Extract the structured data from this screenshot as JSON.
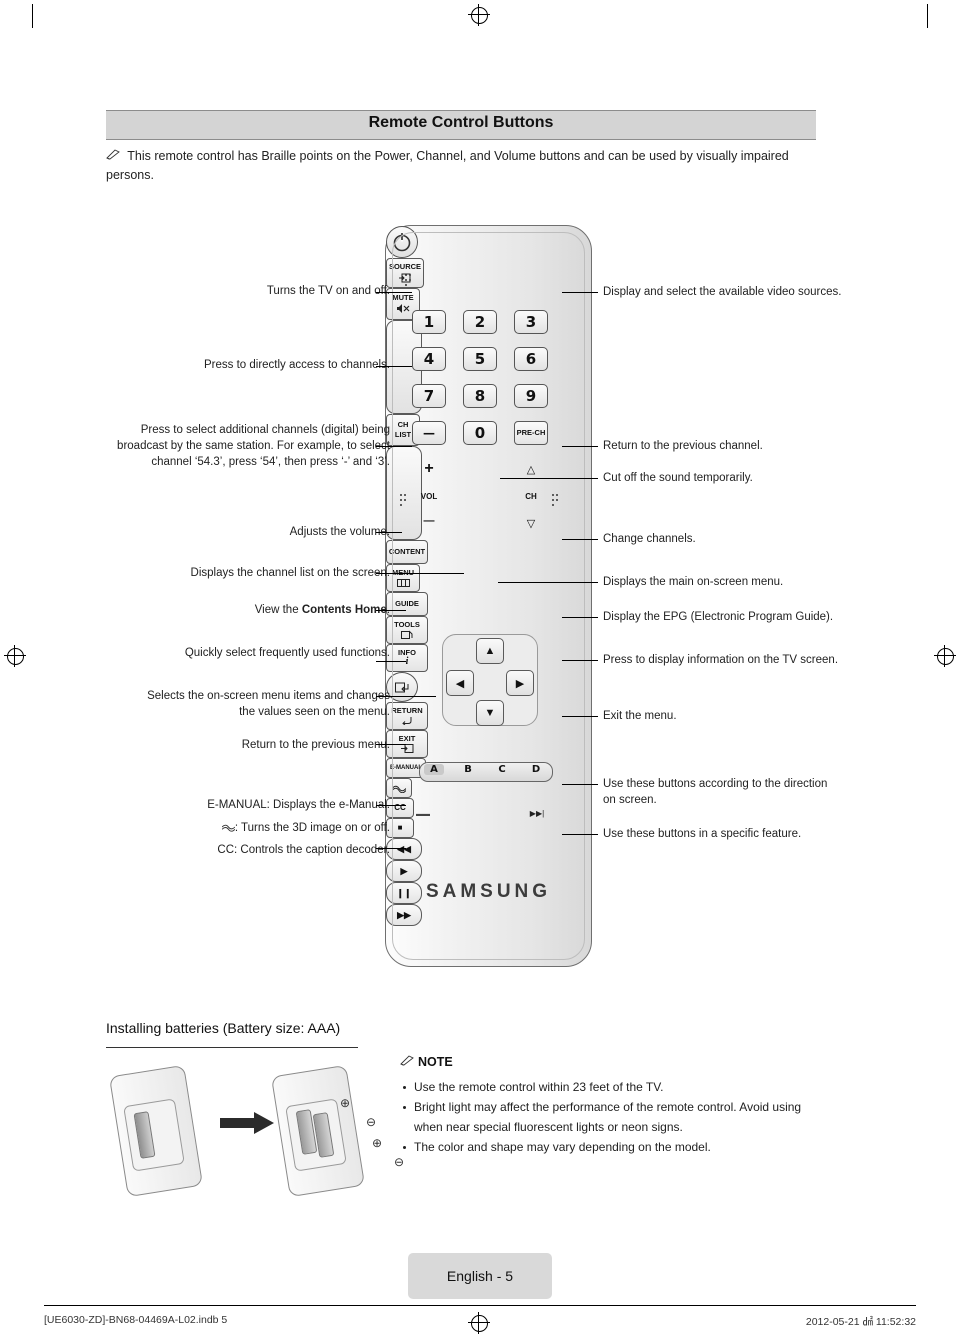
{
  "header": {
    "title": "Remote Control Buttons",
    "note": "This remote control has Braille points on the Power, Channel, and Volume buttons and can be used by visually impaired persons."
  },
  "callouts_left": [
    {
      "id": "power",
      "text": "Turns the TV on and off."
    },
    {
      "id": "numbers",
      "text": "Press to directly access to channels."
    },
    {
      "id": "dash",
      "text": "Press to select additional channels (digital) being broadcast by the same station. For example, to select channel ‘54.3’, press ‘54’, then press ‘-’ and ‘3’."
    },
    {
      "id": "vol",
      "text": "Adjusts the volume."
    },
    {
      "id": "chlist",
      "text": "Displays the channel list on the screen."
    },
    {
      "id": "content",
      "text": "View the Contents Home.",
      "bold": "Contents Home"
    },
    {
      "id": "tools",
      "text": "Quickly select frequently used functions."
    },
    {
      "id": "dpad",
      "text": "Selects the on-screen menu items and changes the values seen on the menu."
    },
    {
      "id": "return",
      "text": "Return to the previous menu."
    },
    {
      "id": "emanual",
      "text": "E-MANUAL: Displays the e-Manual."
    },
    {
      "id": "3d",
      "text": ": Turns the 3D image on or off."
    },
    {
      "id": "cc",
      "text": "CC: Controls the caption decoder."
    }
  ],
  "callouts_right": [
    {
      "id": "source",
      "text": "Display and select the available video sources."
    },
    {
      "id": "precha",
      "text": "Return to the previous channel."
    },
    {
      "id": "mute",
      "text": "Cut off the sound temporarily."
    },
    {
      "id": "ch",
      "text": "Change channels."
    },
    {
      "id": "menu",
      "text": "Displays the main on-screen menu."
    },
    {
      "id": "guide",
      "text": "Display the EPG (Electronic Program Guide)."
    },
    {
      "id": "info",
      "text": "Press to display information on the TV screen."
    },
    {
      "id": "exit",
      "text": "Exit the menu."
    },
    {
      "id": "abcd",
      "text": "Use these buttons according to the direction on screen."
    },
    {
      "id": "media",
      "text": "Use these buttons in a specific feature."
    }
  ],
  "remote": {
    "brand": "SAMSUNG",
    "keys": {
      "power": "power-icon",
      "source": "SOURCE",
      "num1": "1",
      "num2": "2",
      "num3": "3",
      "num4": "4",
      "num5": "5",
      "num6": "6",
      "num7": "7",
      "num8": "8",
      "num9": "9",
      "dash": "—",
      "num0": "0",
      "precha": "PRE-CH",
      "volplus": "+",
      "volminus": "—",
      "vol": "VOL",
      "mute": "MUTE",
      "chlist_line1": "CH",
      "chlist_line2": "LIST",
      "ch": "CH",
      "content": "CONTENT",
      "menu": "MENU",
      "guide": "GUIDE",
      "tools": "TOOLS",
      "info": "INFO",
      "return": "RETURN",
      "exit": "EXIT",
      "color_a": "A",
      "color_b": "B",
      "color_c": "C",
      "color_d": "D",
      "emanual": "E-MANUAL",
      "3d": "3d-icon",
      "cc": "CC",
      "stop": "■",
      "rec": "▬▬",
      "skipfwd": "▶▶|",
      "rew": "◀◀",
      "play": "▶",
      "pause": "❙❙",
      "ff": "▶▶"
    }
  },
  "battery": {
    "title": "Installing batteries (Battery size: AAA)",
    "note_heading": "NOTE",
    "notes": [
      "Use the remote control within 23 feet of the TV.",
      "Bright light may affect the performance of the remote control. Avoid using when near special fluorescent lights or neon signs.",
      "The color and shape may vary depending on the model."
    ]
  },
  "footer": {
    "page_label": "English - 5",
    "file": "[UE6030-ZD]-BN68-04469A-L02.indb   5",
    "timestamp": "2012-05-21   ㍸ 11:52:32"
  }
}
